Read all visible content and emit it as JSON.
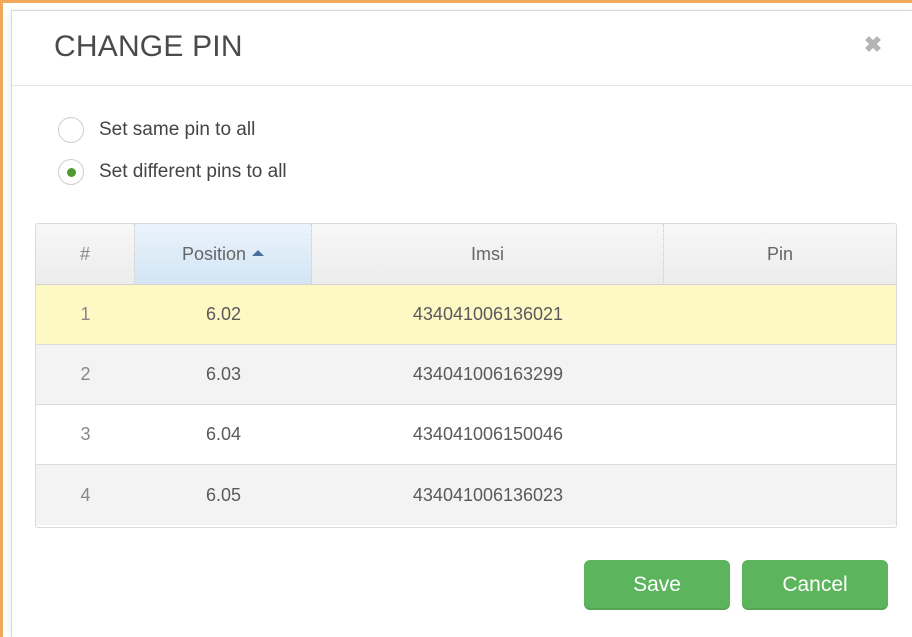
{
  "dialog": {
    "title": "CHANGE PIN",
    "close_icon": "close-icon"
  },
  "options": [
    {
      "label": "Set same pin to all",
      "selected": false
    },
    {
      "label": "Set different pins to all",
      "selected": true
    }
  ],
  "table": {
    "columns": [
      {
        "label": "#"
      },
      {
        "label": "Position",
        "sorted": "ascending"
      },
      {
        "label": "Imsi"
      },
      {
        "label": "Pin"
      }
    ],
    "rows": [
      {
        "num": "1",
        "position": "6.02",
        "imsi": "434041006136021",
        "pin": "",
        "selected": true
      },
      {
        "num": "2",
        "position": "6.03",
        "imsi": "434041006163299",
        "pin": ""
      },
      {
        "num": "3",
        "position": "6.04",
        "imsi": "434041006150046",
        "pin": ""
      },
      {
        "num": "4",
        "position": "6.05",
        "imsi": "434041006136023",
        "pin": ""
      }
    ]
  },
  "buttons": {
    "save": "Save",
    "cancel": "Cancel"
  },
  "colors": {
    "accent_green": "#5cb45c",
    "selected_row": "#fdf8c4",
    "frame_orange": "#f0a95a"
  }
}
